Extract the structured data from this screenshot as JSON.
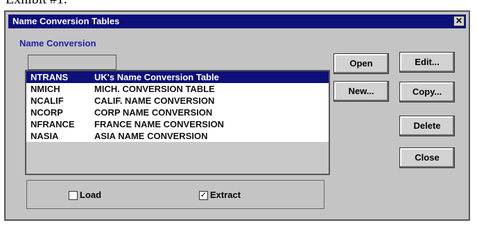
{
  "exhibit_label": "Exhibit #1.",
  "window": {
    "title": "Name Conversion Tables",
    "close_glyph": "✕"
  },
  "group_label": "Name Conversion",
  "name_input": {
    "value": ""
  },
  "list": [
    {
      "code": "NTRANS",
      "name": "UK's Name Conversion  Table",
      "selected": true
    },
    {
      "code": "NMICH",
      "name": "MICH. CONVERSION TABLE"
    },
    {
      "code": "NCALIF",
      "name": "CALIF. NAME CONVERSION"
    },
    {
      "code": "NCORP",
      "name": "CORP NAME CONVERSION"
    },
    {
      "code": "NFRANCE",
      "name": "FRANCE NAME CONVERSION"
    },
    {
      "code": "NASIA",
      "name": "ASIA NAME CONVERSION"
    }
  ],
  "options": {
    "load": {
      "label": "Load",
      "checked": false
    },
    "extract": {
      "label": "Extract",
      "checked": true
    },
    "check_glyph": "✓"
  },
  "buttons": {
    "open": "Open",
    "edit": "Edit...",
    "new": "New...",
    "copy": "Copy...",
    "delete": "Delete",
    "close": "Close"
  },
  "colors": {
    "title_bar": "#0d0f7a",
    "window_bg": "#c4c4c4",
    "selection": "#0d0f7a",
    "group_label": "#1f1ea8"
  }
}
